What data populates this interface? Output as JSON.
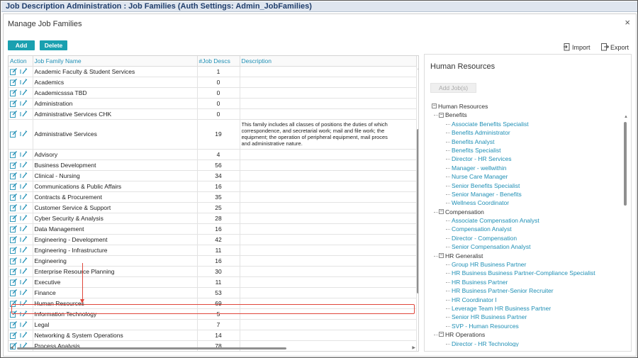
{
  "window": {
    "title": "Job Description Administration : Job Families (Auth Settings: Admin_JobFamilies)"
  },
  "dialog": {
    "title": "Manage Job Families",
    "close_glyph": "×"
  },
  "toolbar": {
    "add_label": "Add",
    "delete_label": "Delete",
    "import_label": "Import",
    "export_label": "Export"
  },
  "grid": {
    "columns": [
      "Action",
      "Job Family Name",
      "#Job Descs",
      "Description"
    ],
    "rows": [
      {
        "name": "Academic Faculty & Student Services",
        "count": "1",
        "description": ""
      },
      {
        "name": "Academics",
        "count": "0",
        "description": ""
      },
      {
        "name": "Academicsssa TBD",
        "count": "0",
        "description": ""
      },
      {
        "name": "Administration",
        "count": "0",
        "description": ""
      },
      {
        "name": "Administrative Services CHK",
        "count": "0",
        "description": ""
      },
      {
        "name": "Administrative Services",
        "count": "19",
        "description": "This family includes all classes of positions the duties of which\ncorrespondence, and secretarial work; mail and file work; the\nequipment; the operation of peripheral equipment, mail proces\nand administrative nature."
      },
      {
        "name": "Advisory",
        "count": "4",
        "description": ""
      },
      {
        "name": "Business Development",
        "count": "56",
        "description": ""
      },
      {
        "name": "Clinical - Nursing",
        "count": "34",
        "description": ""
      },
      {
        "name": "Communications & Public Affairs",
        "count": "16",
        "description": ""
      },
      {
        "name": "Contracts & Procurement",
        "count": "35",
        "description": ""
      },
      {
        "name": "Customer Service & Support",
        "count": "25",
        "description": ""
      },
      {
        "name": "Cyber Security & Analysis",
        "count": "28",
        "description": ""
      },
      {
        "name": "Data Management",
        "count": "16",
        "description": ""
      },
      {
        "name": "Engineering - Development",
        "count": "42",
        "description": ""
      },
      {
        "name": "Engineering - Infrastructure",
        "count": "11",
        "description": ""
      },
      {
        "name": "Engineering",
        "count": "16",
        "description": ""
      },
      {
        "name": "Enterprise Resource Planning",
        "count": "30",
        "description": ""
      },
      {
        "name": "Executive",
        "count": "11",
        "description": ""
      },
      {
        "name": "Finance",
        "count": "53",
        "description": ""
      },
      {
        "name": "Human Resources",
        "count": "69",
        "description": ""
      },
      {
        "name": "Information Technology",
        "count": "5",
        "description": ""
      },
      {
        "name": "Legal",
        "count": "7",
        "description": ""
      },
      {
        "name": "Networking & System Operations",
        "count": "14",
        "description": ""
      },
      {
        "name": "Process Analysis",
        "count": "78",
        "description": ""
      }
    ],
    "selected_row_name": "Human Resources"
  },
  "tree_panel": {
    "title": "Human Resources",
    "add_jobs_label": "Add Job(s)",
    "nodes": [
      {
        "level": 0,
        "label": "Human Resources",
        "expander": "⊟"
      },
      {
        "level": 1,
        "label": "Benefits",
        "expander": "⊟"
      },
      {
        "level": 2,
        "label": "Associate Benefits Specialist"
      },
      {
        "level": 2,
        "label": "Benefits Administrator"
      },
      {
        "level": 2,
        "label": "Benefits Analyst"
      },
      {
        "level": 2,
        "label": "Benefits Specialist"
      },
      {
        "level": 2,
        "label": "Director - HR Services"
      },
      {
        "level": 2,
        "label": "Manager - wellwithin"
      },
      {
        "level": 2,
        "label": "Nurse Care Manager"
      },
      {
        "level": 2,
        "label": "Senior Benefits Specialist"
      },
      {
        "level": 2,
        "label": "Senior Manager - Benefits"
      },
      {
        "level": 2,
        "label": "Wellness Coordinator"
      },
      {
        "level": 1,
        "label": "Compensation",
        "expander": "⊟"
      },
      {
        "level": 2,
        "label": "Associate Compensation Analyst"
      },
      {
        "level": 2,
        "label": "Compensation Analyst"
      },
      {
        "level": 2,
        "label": "Director - Compensation"
      },
      {
        "level": 2,
        "label": "Senior Compensation Analyst"
      },
      {
        "level": 1,
        "label": "HR Generalist",
        "expander": "⊟"
      },
      {
        "level": 2,
        "label": "Group HR Business Partner"
      },
      {
        "level": 2,
        "label": "HR Business Business Partner-Compliance Specialist"
      },
      {
        "level": 2,
        "label": "HR Business Partner"
      },
      {
        "level": 2,
        "label": "HR Business Partner-Senior Recruiter"
      },
      {
        "level": 2,
        "label": "HR Coordinator I"
      },
      {
        "level": 2,
        "label": "Leverage Team HR Business Partner"
      },
      {
        "level": 2,
        "label": "Senior HR Business Partner"
      },
      {
        "level": 2,
        "label": "SVP - Human Resources"
      },
      {
        "level": 1,
        "label": "HR Operations",
        "expander": "⊟"
      },
      {
        "level": 2,
        "label": "Director - HR Technology"
      }
    ]
  },
  "colors": {
    "accent": "#1aa0b0",
    "link": "#1f8fb5",
    "highlight": "#e0473c",
    "title_text": "#1f3d6b"
  },
  "icons": [
    "edit-icon",
    "view-icon",
    "import-icon",
    "export-icon",
    "close-icon",
    "collapse-icon"
  ]
}
